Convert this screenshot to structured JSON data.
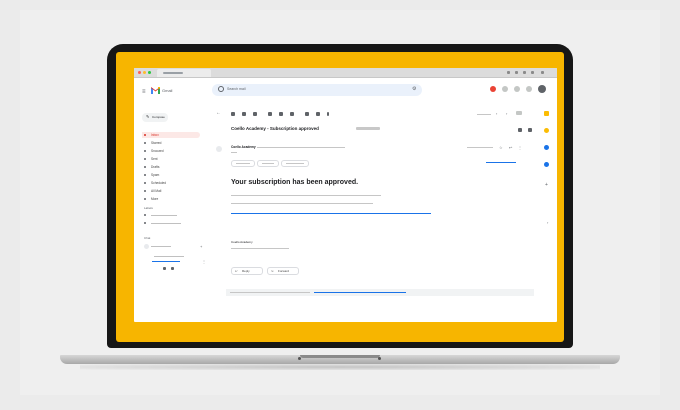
{
  "gmail": {
    "app_name": "Gmail",
    "search_placeholder": "Search mail",
    "compose_label": "Compose",
    "nav": [
      {
        "label": "Inbox",
        "active": true
      },
      {
        "label": "Starred"
      },
      {
        "label": "Snoozed"
      },
      {
        "label": "Sent"
      },
      {
        "label": "Drafts"
      },
      {
        "label": "Spam"
      },
      {
        "label": "Scheduled"
      },
      {
        "label": "All Mail"
      },
      {
        "label": "More"
      }
    ],
    "labels_heading": "Labels",
    "chat_heading": "Chat",
    "subject": "Coello Academy - Subscription approved",
    "sender": "Coello Academy",
    "heading": "Your subscription has been approved.",
    "signature": "Coello Academy",
    "reply_label": "Reply",
    "forward_label": "Forward"
  },
  "colors": {
    "background": "#ebebeb",
    "laptop_bezel": "#161616",
    "wallpaper": "#f7b500",
    "gmail_red": "#d93025",
    "link_blue": "#1a73e8",
    "search_bg": "#eaf1fb"
  },
  "icons": [
    "menu-icon",
    "gmail-logo-icon",
    "search-icon",
    "tune-icon",
    "help-icon",
    "settings-icon",
    "apps-icon",
    "avatar",
    "archive-icon",
    "report-icon",
    "delete-icon",
    "mark-unread-icon",
    "snooze-icon",
    "move-icon",
    "label-icon",
    "more-icon",
    "print-icon",
    "reply-icon",
    "forward-icon",
    "star-icon"
  ]
}
